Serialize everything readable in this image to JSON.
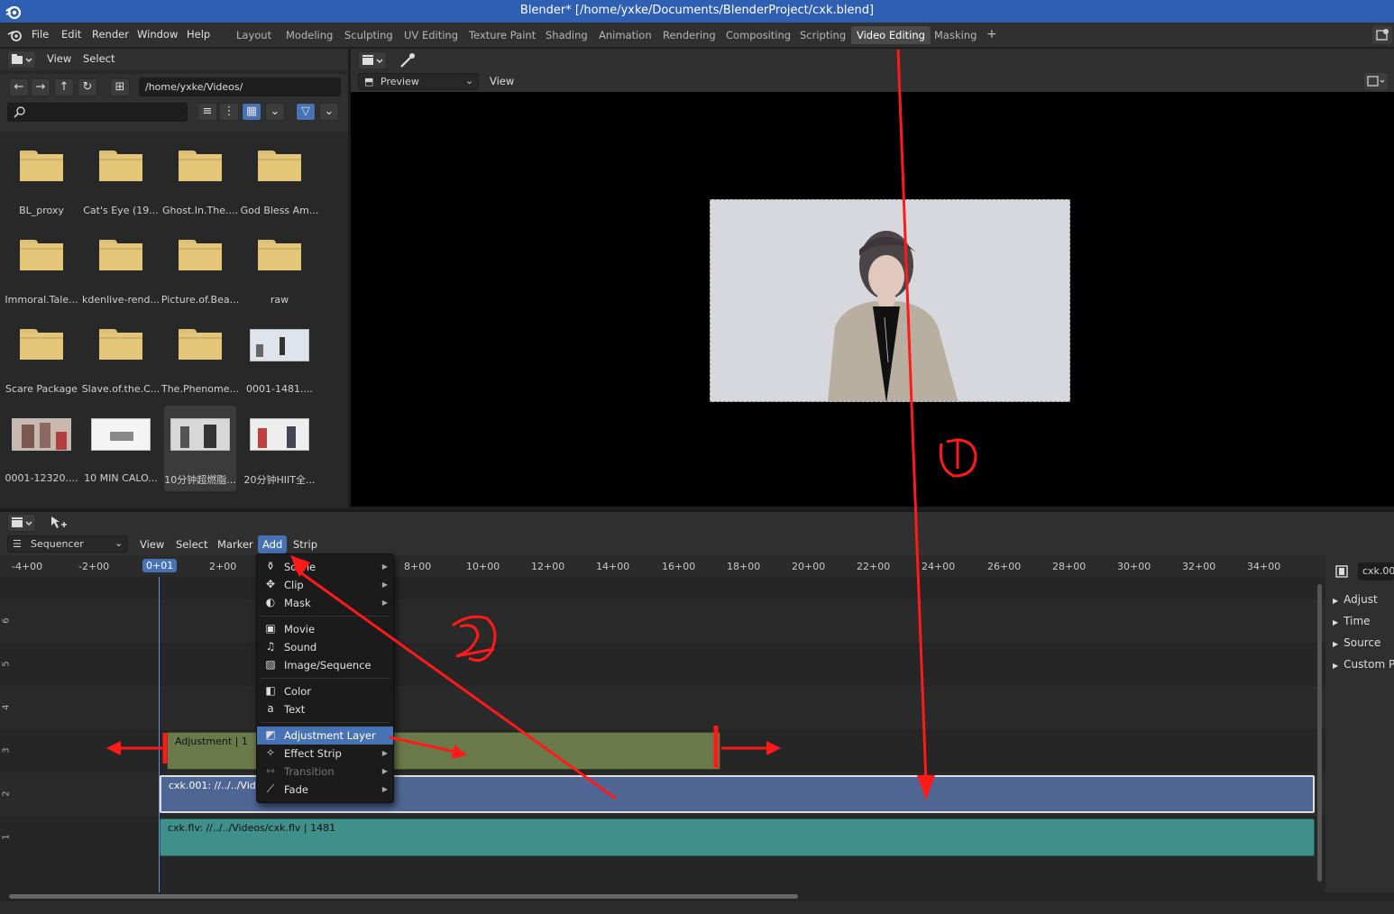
{
  "window": {
    "title": "Blender* [/home/yxke/Documents/BlenderProject/cxk.blend]"
  },
  "menubar": {
    "items": [
      "File",
      "Edit",
      "Render",
      "Window",
      "Help"
    ]
  },
  "workspaces": {
    "tabs": [
      "Layout",
      "Modeling",
      "Sculpting",
      "UV Editing",
      "Texture Paint",
      "Shading",
      "Animation",
      "Rendering",
      "Compositing",
      "Scripting",
      "Video Editing",
      "Masking"
    ],
    "active": "Video Editing",
    "add": "+"
  },
  "file_browser": {
    "header": {
      "view": "View",
      "select": "Select"
    },
    "path": "/home/yxke/Videos/",
    "search_placeholder": "",
    "items": [
      {
        "label": "BL_proxy",
        "kind": "folder"
      },
      {
        "label": "Cat's Eye (19...",
        "kind": "folder"
      },
      {
        "label": "Ghost.In.The....",
        "kind": "folder"
      },
      {
        "label": "God Bless Am...",
        "kind": "folder"
      },
      {
        "label": "Immoral.Tale...",
        "kind": "folder"
      },
      {
        "label": "kdenlive-rend...",
        "kind": "folder"
      },
      {
        "label": "Picture.of.Bea...",
        "kind": "folder"
      },
      {
        "label": "raw",
        "kind": "folder"
      },
      {
        "label": "Scare Package",
        "kind": "folder"
      },
      {
        "label": "Slave.of.the.C...",
        "kind": "folder"
      },
      {
        "label": "The.Phenome...",
        "kind": "folder"
      },
      {
        "label": "0001-1481....",
        "kind": "video"
      },
      {
        "label": "0001-12320....",
        "kind": "video"
      },
      {
        "label": "10 MIN CALO...",
        "kind": "video"
      },
      {
        "label": "10分钟超燃脂...",
        "kind": "video"
      },
      {
        "label": "20分钟HIIT全...",
        "kind": "video"
      }
    ]
  },
  "preview": {
    "mode": "Preview",
    "view": "View"
  },
  "sequencer": {
    "mode": "Sequencer",
    "menu": [
      "View",
      "Select",
      "Marker",
      "Add",
      "Strip"
    ],
    "active_menu": "Add",
    "current_frame": "0+01",
    "ruler": [
      "-4+00",
      "-2+00",
      "0+01",
      "2+00",
      "8+00",
      "10+00",
      "12+00",
      "14+00",
      "16+00",
      "18+00",
      "20+00",
      "22+00",
      "24+00",
      "26+00",
      "28+00",
      "30+00",
      "32+00",
      "34+00"
    ],
    "tracks": [
      "6",
      "5",
      "4",
      "3",
      "2",
      "1"
    ],
    "strips": [
      {
        "channel": 3,
        "label": "Adjustment | 1",
        "color": "#6b7a4a"
      },
      {
        "channel": 2,
        "label": "cxk.001: //../../Vide",
        "color": "#4f6695"
      },
      {
        "channel": 1,
        "label": "cxk.flv: //../../Videos/cxk.flv | 1481",
        "color": "#3f8f8a"
      }
    ]
  },
  "add_menu": {
    "items": [
      {
        "label": "Scene",
        "icon": "scene-icon",
        "submenu": true
      },
      {
        "label": "Clip",
        "icon": "clip-icon",
        "submenu": true
      },
      {
        "label": "Mask",
        "icon": "mask-icon",
        "submenu": true
      },
      {
        "label": "Movie",
        "icon": "movie-icon",
        "submenu": false
      },
      {
        "label": "Sound",
        "icon": "sound-icon",
        "submenu": false
      },
      {
        "label": "Image/Sequence",
        "icon": "image-icon",
        "submenu": false
      },
      {
        "label": "Color",
        "icon": "color-icon",
        "submenu": false
      },
      {
        "label": "Text",
        "icon": "text-icon",
        "submenu": false
      },
      {
        "label": "Adjustment Layer",
        "icon": "adjustment-icon",
        "submenu": false,
        "active": true
      },
      {
        "label": "Effect Strip",
        "icon": "effect-icon",
        "submenu": true
      },
      {
        "label": "Transition",
        "icon": "transition-icon",
        "submenu": true,
        "disabled": true
      },
      {
        "label": "Fade",
        "icon": "fade-icon",
        "submenu": true
      }
    ]
  },
  "sidebar": {
    "strip_name": "cxk.00",
    "panels": [
      "Adjust",
      "Time",
      "Source",
      "Custom P"
    ]
  },
  "annotations": {
    "one": "①",
    "two": "②"
  },
  "colors": {
    "accent": "#4772b3",
    "annotation": "#ff1a1a"
  }
}
